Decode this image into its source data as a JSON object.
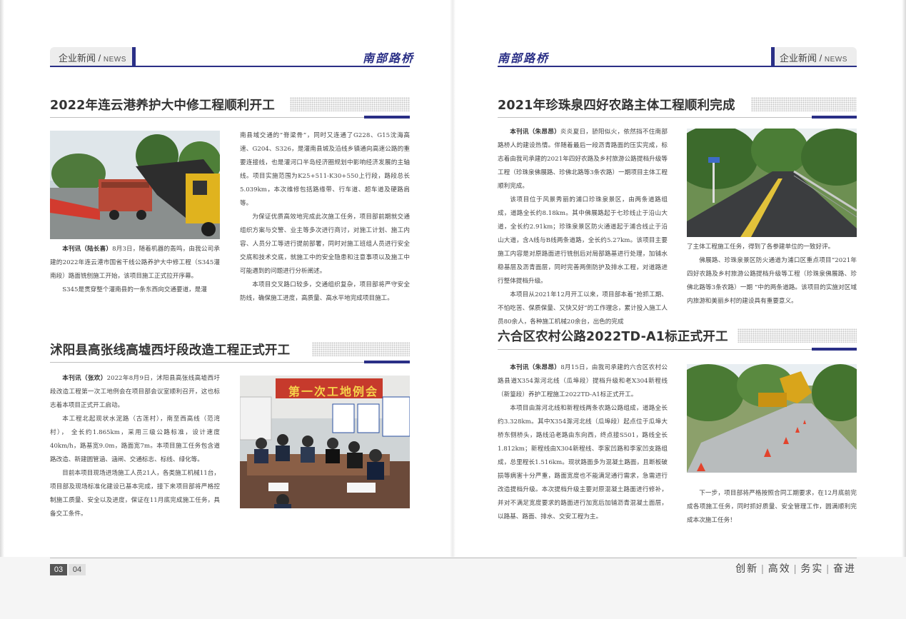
{
  "header": {
    "category_cn": "企业新闻",
    "category_sep": "/",
    "category_en": "NEWS",
    "brand": "南部路桥"
  },
  "articles": [
    {
      "title": "2022年连云港养护大中修工程顺利开工",
      "paragraphs_left": [
        {
          "by": "本刊讯（陆长喜）",
          "text": "8月3日，随着机器的轰鸣，由我公司承建的2022年连云港市国省干线公路养护大中修工程（S345灌南段）路面铣刨施工开始，该项目施工正式拉开序幕。"
        },
        {
          "by": "",
          "text": "S345是贯穿整个灌南县的一条东西向交通要道，是灌"
        }
      ],
      "paragraphs_right": [
        {
          "text": "南县域交通的“脊梁骨”，同时又连通了G228、G15沈海高速、G204、S326，是灌南县城及沿线乡镇通向高速公路的重要连接线，也是灌河口半岛经济圈规划中影响经济发展的主轴线。项目实施范围为K25+511-K30+550上行段，路段总长5.039km，本次维修包括路缘带、行车道、超车道及硬路肩等。",
          "noindent": true
        },
        {
          "text": "为保证优质高效地完成此次施工任务，项目部前期就交通组织方案与交警、业主等多次进行商讨，对施工计划、施工内容、人员分工等进行提前部署，同时对施工班组人员进行安全交底和技术交底，就施工中的安全隐患和注意事项以及施工中可能遇到的问题进行分析阐述。"
        },
        {
          "text": "本项目交叉路口较多，交通组织复杂，项目部将严守安全防线，确保施工进度，高质量、高水平地完成项目施工。"
        }
      ]
    },
    {
      "title": "沭阳县高张线高墟西圩段改造工程正式开工",
      "paragraphs": [
        {
          "by": "本刊讯（张欢）",
          "text": "2022年8月9日，沭阳县高张线高墟西圩段改造工程第一次工地例会在项目部会议室顺利召开，这也标志着本项目正式开工启动。"
        },
        {
          "by": "",
          "text": "本工程北起现状水泥路（古莲村），南至西高线（范湾村）， 全长约1.865km，采用三级公路标准，设计速度40km/h，路基宽9.0m，路面宽7m。本项目施工任务包含道路改造、新建圆管涵、涵闸、交通标志、标线、绿化等。"
        },
        {
          "by": "",
          "text": "目前本项目现场进场施工人员21人，各类施工机械11台，项目部及现场标准化建设已基本完成，接下来项目部将严格控制施工质量、安全以及进度，保证在11月底完成施工任务，具备交工条件。"
        }
      ],
      "banner": "第一次工地例会"
    },
    {
      "title": "2021年珍珠泉四好农路主体工程顺利完成",
      "paragraphs_left": [
        {
          "by": "本刊讯（朱昂昂）",
          "text": "炎炎夏日，骄阳似火，依然挡不住南部路桥人的建设热情。伴随着最后一段沥青路面的压实完成，标志着由我司承建的2021年四好农路及乡村旅游公路提档升级等工程（珍珠泉佛展路、珍佛北路等3条农路）一期项目主体工程顺利完成。"
        },
        {
          "by": "",
          "text": "该项目位于风景秀丽的浦口珍珠泉景区，由两条道路组成，道路全长约8.18km。其中佛展路起于七珍线止于沿山大道，全长约2.91km；珍珠泉景区防火通道起于浦合线止于沿山大道，含A线与B线两条道路，全长约5.27km。该项目主要施工内容是对原路面进行铣刨后对局部路基进行处理，加铺水稳基层及沥青面层，同时完善两侧防护及排水工程，对道路进行整体提档升级。"
        },
        {
          "by": "",
          "text": "本项目从2021年12月开工以来，项目部本着“抢抓工期、不怕吃苦、保质保量、又快又好”的工作理念，累计投入施工人员80余人，各种施工机械20余台，出色的完成"
        }
      ],
      "paragraphs_right": [
        {
          "text": "了主体工程施工任务，得到了各参建单位的一致好评。",
          "noindent": true
        },
        {
          "text": "佛展路、珍珠泉景区防火通道为浦口区重点项目“2021年四好农路及乡村旅游公路提档升级等工程（珍珠泉佛展路、珍佛北路等3条农路）一期 ”中的两条道路。该项目的实施对区域内旅游和美丽乡村的建设具有重要意义。"
        }
      ]
    },
    {
      "title": "六合区农村公路2022TD-A1标正式开工",
      "paragraphs_left": [
        {
          "by": "本刊讯（朱昂昂）",
          "text": "8月15日，由我司承建的六合区农村公路县道X354滁河北线（瓜埠段）提档升级和老X304新程线（新篁段）养护工程施工2022TD-A1标正式开工。"
        },
        {
          "by": "",
          "text": "本项目由滁河北线和新程线两条农路公路组成，道路全长约3.328km。其中X354滁河北线（瓜埠段）起点位于瓜埠大桥东侧桥头，路线沿老路由东向西，终点接S501，路线全长1.812km；新程线由X304新程线、李家凹路和李家凹支路组成，总里程长1.516km。现状路面多为混凝土路面，且断板破损等病害十分严重，路面宽度也不能满足通行需求，急需进行改造提档升级。本次提档升级主要对原混凝土路面进行修补，并对不满足宽度要求的路面进行加宽后加铺沥青混凝土面层，以路基、路面、排水、交安工程为主。"
        }
      ],
      "paragraphs_right": [
        {
          "text": "下一步，项目部将严格按照合同工期要求，在12月底前完成各项施工任务，同时抓好质量、安全管理工作，圆满顺利完成本次施工任务！"
        }
      ]
    }
  ],
  "footer": {
    "page_left": "03",
    "page_right": "04",
    "slogan": [
      "创新",
      "高效",
      "务实",
      "奋进"
    ]
  },
  "colors": {
    "accent": "#2a2f86",
    "header_bg": "#ededed",
    "text": "#444444"
  }
}
